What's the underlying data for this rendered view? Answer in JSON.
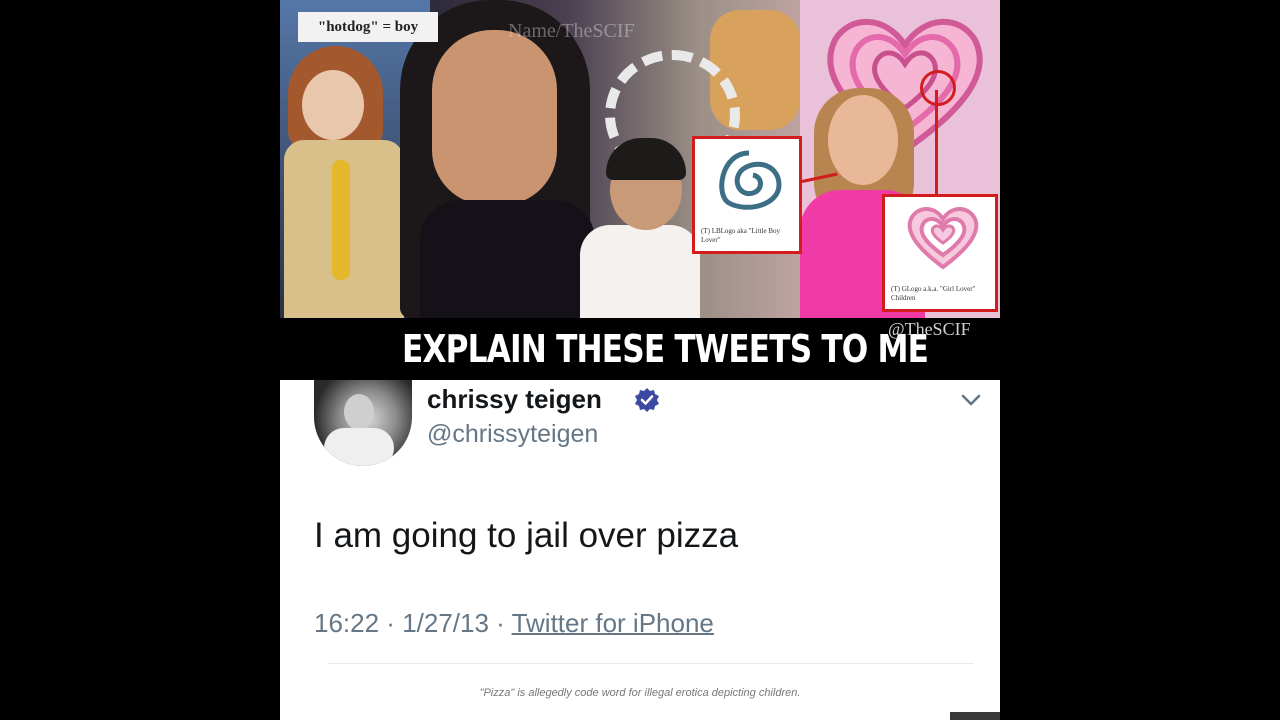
{
  "collage": {
    "caption_label": "\"hotdog\" = boy",
    "watermark": "Name/TheSCIF",
    "symbol_caption": "(T) LBLogo aka \"Little Boy Lover\"",
    "heart_caption": "(T) GLogo a.k.a. \"Girl Lover\" Children"
  },
  "banner": {
    "title": "EXPLAIN THESE TWEETS TO ME",
    "handle": "@TheSCIF"
  },
  "tweet": {
    "display_name": "chrissy teigen",
    "username": "@chrissyteigen",
    "text": "I am going to jail over pizza",
    "time": "16:22",
    "date": "1/27/13",
    "separator": " · ",
    "source": "Twitter for iPhone",
    "footnote": "\"Pizza\" is allegedly code word for illegal erotica depicting children.",
    "verified_color": "#3b4aa0",
    "icons": [
      "verified-badge-icon",
      "chevron-down-icon"
    ]
  }
}
